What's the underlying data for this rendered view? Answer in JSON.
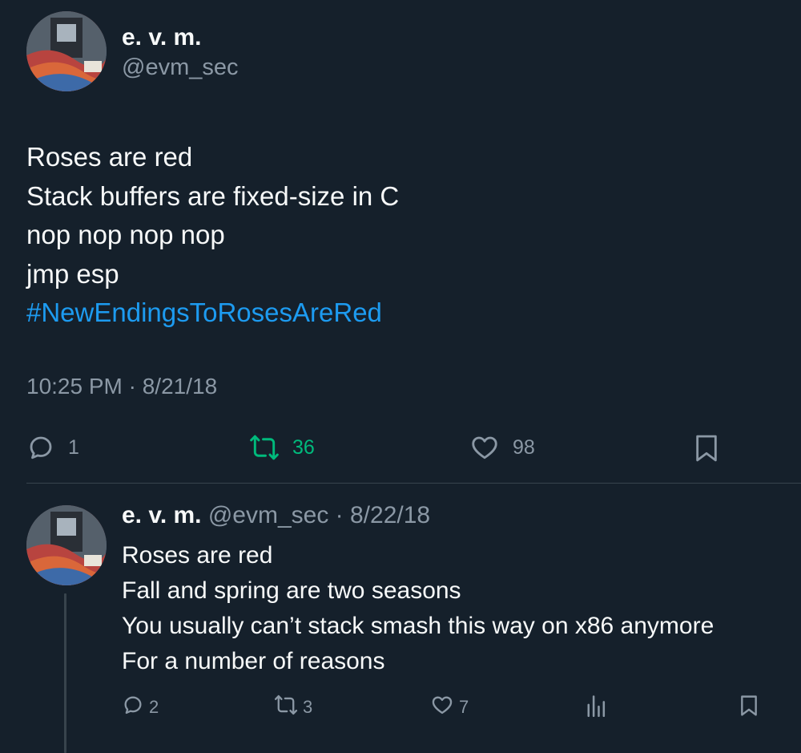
{
  "colors": {
    "background": "#15202b",
    "text_primary": "#f7f9f9",
    "text_secondary": "#8b98a5",
    "link": "#1d9bf0",
    "retweet_active": "#00ba7c",
    "divider": "#38444d"
  },
  "tweet": {
    "author_name": "e. v. m.",
    "author_handle": "@evm_sec",
    "lines": [
      "Roses are red",
      "Stack buffers are fixed-size in C",
      "nop nop nop nop",
      "jmp esp"
    ],
    "hashtag": "#NewEndingsToRosesAreRed",
    "timestamp": "10:25 PM · 8/21/18",
    "actions": {
      "reply_icon": "reply-icon",
      "reply_count": "1",
      "retweet_icon": "retweet-icon",
      "retweet_count": "36",
      "like_icon": "heart-icon",
      "like_count": "98",
      "bookmark_icon": "bookmark-icon"
    }
  },
  "reply": {
    "author_name": "e. v. m.",
    "meta": "@evm_sec · 8/22/18",
    "lines": [
      "Roses are red",
      "Fall and spring are two seasons",
      "You usually can’t stack smash this way on x86 anymore",
      "For a number of reasons"
    ],
    "actions": {
      "reply_count": "2",
      "retweet_count": "3",
      "like_count": "7",
      "views_icon": "analytics-icon",
      "bookmark_icon": "bookmark-icon"
    }
  }
}
